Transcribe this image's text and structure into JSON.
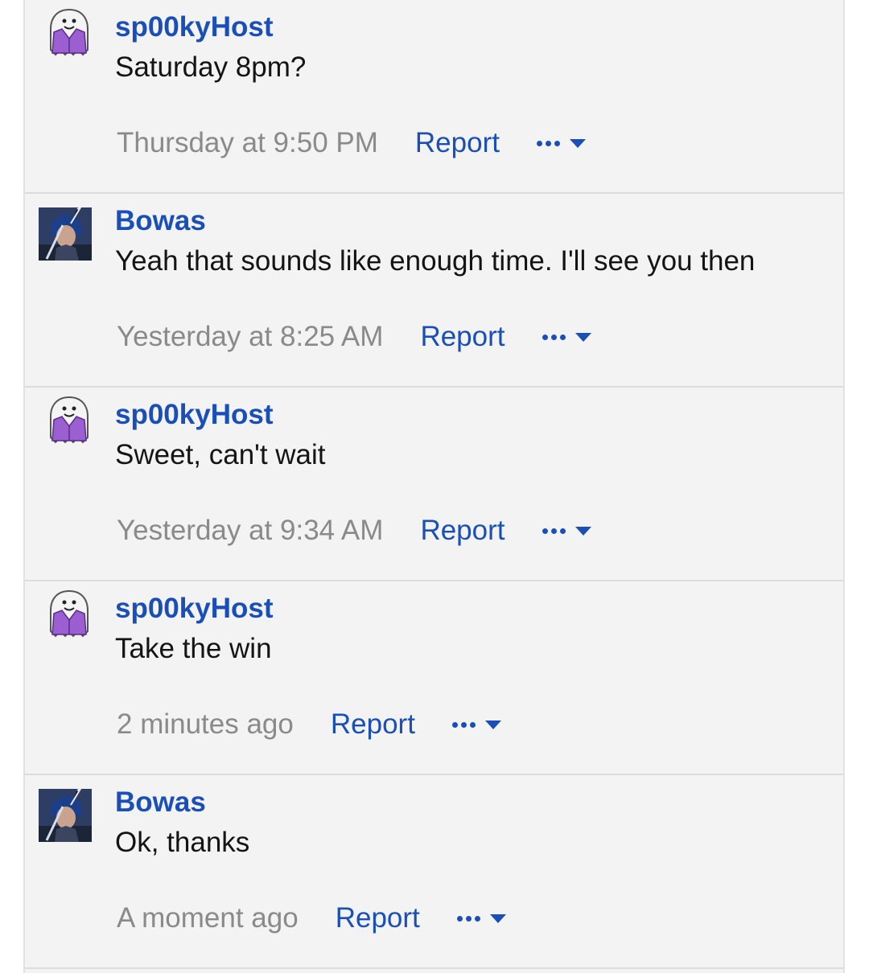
{
  "colors": {
    "link": "#1a4fb8",
    "meta": "#8a8a8a",
    "text": "#141414",
    "background": "#f3f3f3"
  },
  "icons": {
    "more": "ellipsis-icon",
    "dropdown": "caret-down-icon"
  },
  "messages": [
    {
      "author": "sp00kyHost",
      "avatar": "ghost-avatar",
      "text": "Saturday 8pm?",
      "time": "Thursday at 9:50 PM",
      "report_label": "Report"
    },
    {
      "author": "Bowas",
      "avatar": "photo-avatar",
      "text": "Yeah that sounds like enough time. I'll see you then",
      "time": "Yesterday at 8:25 AM",
      "report_label": "Report"
    },
    {
      "author": "sp00kyHost",
      "avatar": "ghost-avatar",
      "text": "Sweet, can't wait",
      "time": "Yesterday at 9:34 AM",
      "report_label": "Report"
    },
    {
      "author": "sp00kyHost",
      "avatar": "ghost-avatar",
      "text": "Take the win",
      "time": "2 minutes ago",
      "report_label": "Report"
    },
    {
      "author": "Bowas",
      "avatar": "photo-avatar",
      "text": "Ok, thanks",
      "time": "A moment ago",
      "report_label": "Report"
    }
  ]
}
